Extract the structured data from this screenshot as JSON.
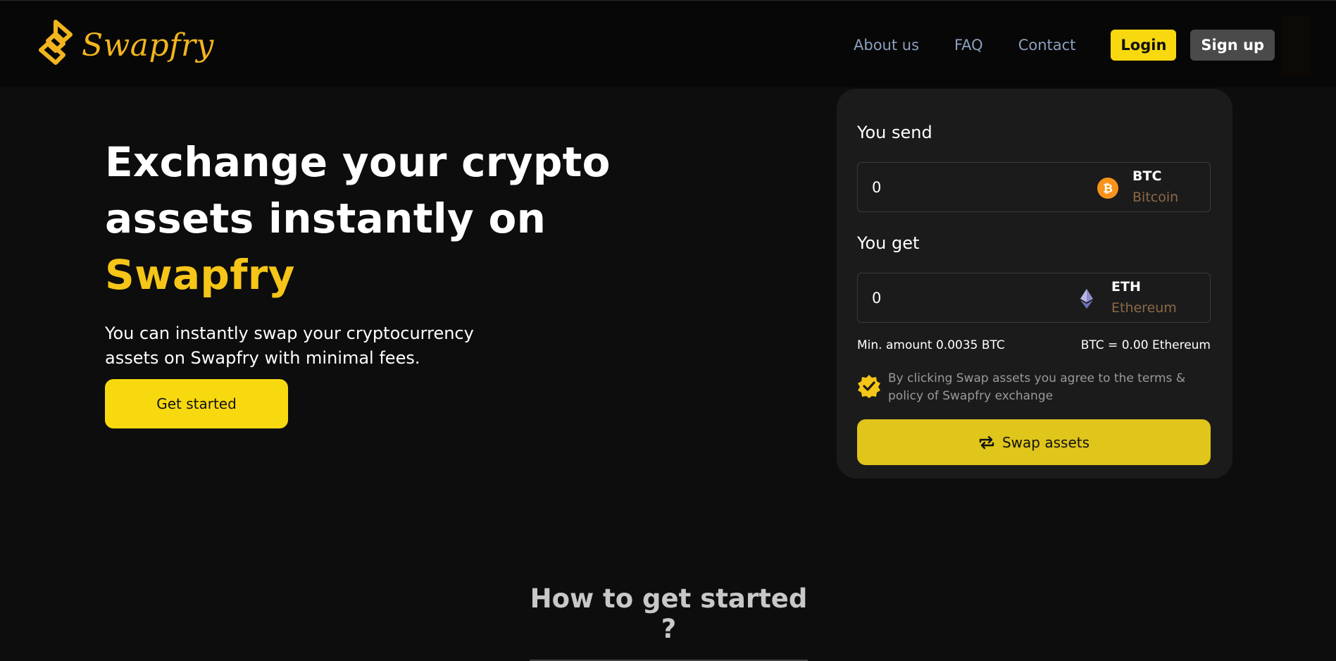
{
  "brand": {
    "name": "Swapfry",
    "color": "#f2b51e"
  },
  "nav": {
    "links": [
      "About us",
      "FAQ",
      "Contact"
    ],
    "login_label": "Login",
    "signup_label": "Sign up"
  },
  "hero": {
    "title_line1": "Exchange your crypto",
    "title_line2": "assets instantly on",
    "title_accent": "Swapfry",
    "subtitle": "You can instantly swap your cryptocurrency assets on Swapfry with minimal fees.",
    "cta_label": "Get started"
  },
  "swap": {
    "send_label": "You send",
    "send_value": "0",
    "send_coin": {
      "symbol": "BTC",
      "name": "Bitcoin",
      "icon": "bitcoin-icon",
      "color": "#f7931a"
    },
    "get_label": "You get",
    "get_value": "0",
    "get_coin": {
      "symbol": "ETH",
      "name": "Ethereum",
      "icon": "ethereum-icon",
      "color": "#8c8fc9"
    },
    "min_amount": "Min. amount 0.0035 BTC",
    "rate": "BTC = 0.00 Ethereum",
    "agreement": "By clicking Swap assets you agree to the terms & policy of Swapfry exchange",
    "button_label": "Swap assets",
    "accent_color": "#e0c51a"
  },
  "section": {
    "heading": "How to get started ?"
  }
}
